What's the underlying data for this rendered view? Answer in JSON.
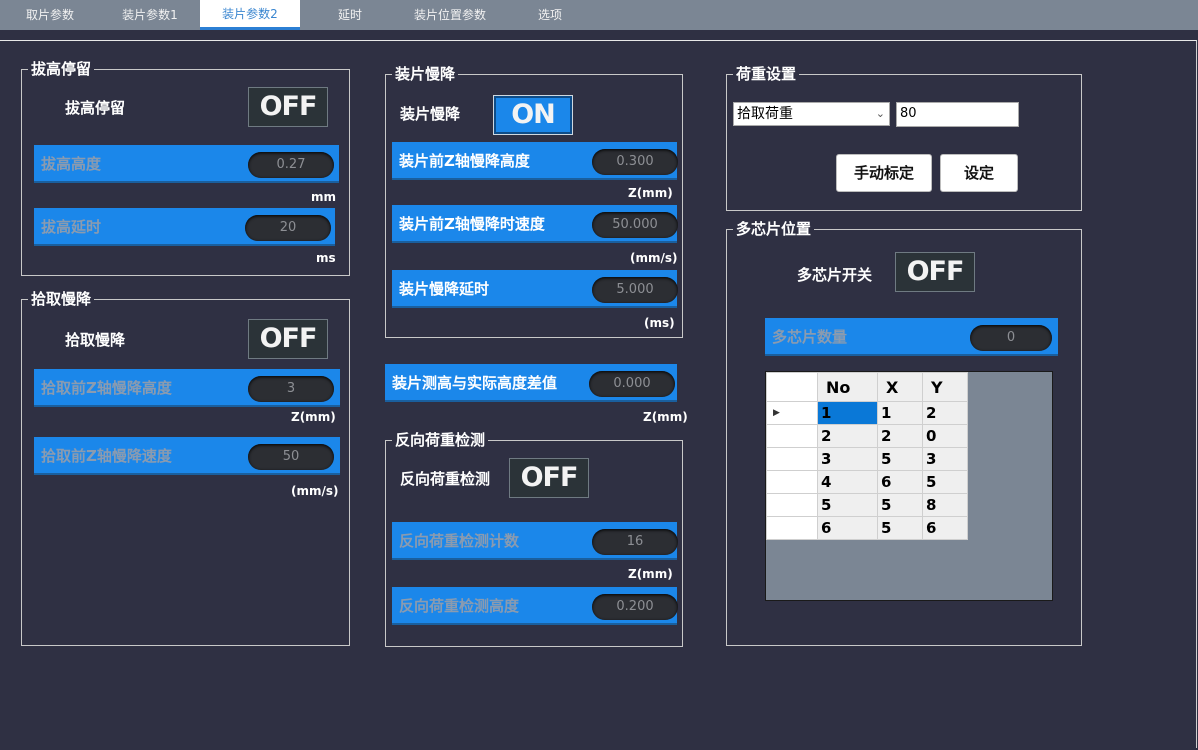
{
  "tabs": [
    "取片参数",
    "装片参数1",
    "装片参数2",
    "延时",
    "装片位置参数",
    "选项"
  ],
  "bahigh": {
    "title": "拔高停留",
    "switch_label": "拔高停留",
    "switch_state": "OFF",
    "height_label": "拔高高度",
    "height_value": "0.27",
    "height_unit": "mm",
    "delay_label": "拔高延时",
    "delay_value": "20",
    "delay_unit": "ms"
  },
  "pickslow": {
    "title": "拾取慢降",
    "switch_label": "拾取慢降",
    "switch_state": "OFF",
    "height_label": "拾取前Z轴慢降高度",
    "height_value": "3",
    "height_unit": "Z(mm)",
    "speed_label": "拾取前Z轴慢降速度",
    "speed_value": "50",
    "speed_unit": "(mm/s)"
  },
  "loadslow": {
    "title": "装片慢降",
    "switch_label": "装片慢降",
    "switch_state": "ON",
    "height_label": "装片前Z轴慢降高度",
    "height_value": "0.300",
    "height_unit": "Z(mm)",
    "speed_label": "装片前Z轴慢降时速度",
    "speed_value": "50.000",
    "speed_unit": "(mm/s)",
    "delay_label": "装片慢降延时",
    "delay_value": "5.000",
    "delay_unit": "(ms)"
  },
  "heightdiff": {
    "label": "装片测高与实际高度差值",
    "value": "0.000",
    "unit": "Z(mm)"
  },
  "reverse": {
    "title": "反向荷重检测",
    "switch_label": "反向荷重检测",
    "switch_state": "OFF",
    "count_label": "反向荷重检测计数",
    "count_value": "16",
    "count_unit": "Z(mm)",
    "height_label": "反向荷重检测高度",
    "height_value": "0.200"
  },
  "load": {
    "title": "荷重设置",
    "select_value": "拾取荷重",
    "input_value": "80",
    "calibrate_button": "手动标定",
    "set_button": "设定"
  },
  "multichip": {
    "title": "多芯片位置",
    "switch_label": "多芯片开关",
    "switch_state": "OFF",
    "count_label": "多芯片数量",
    "count_value": "0",
    "columns": [
      "No",
      "X",
      "Y"
    ],
    "rows": [
      [
        "1",
        "1",
        "2"
      ],
      [
        "2",
        "2",
        "0"
      ],
      [
        "3",
        "5",
        "3"
      ],
      [
        "4",
        "6",
        "5"
      ],
      [
        "5",
        "5",
        "8"
      ],
      [
        "6",
        "5",
        "6"
      ]
    ],
    "row_marker": "▶"
  }
}
